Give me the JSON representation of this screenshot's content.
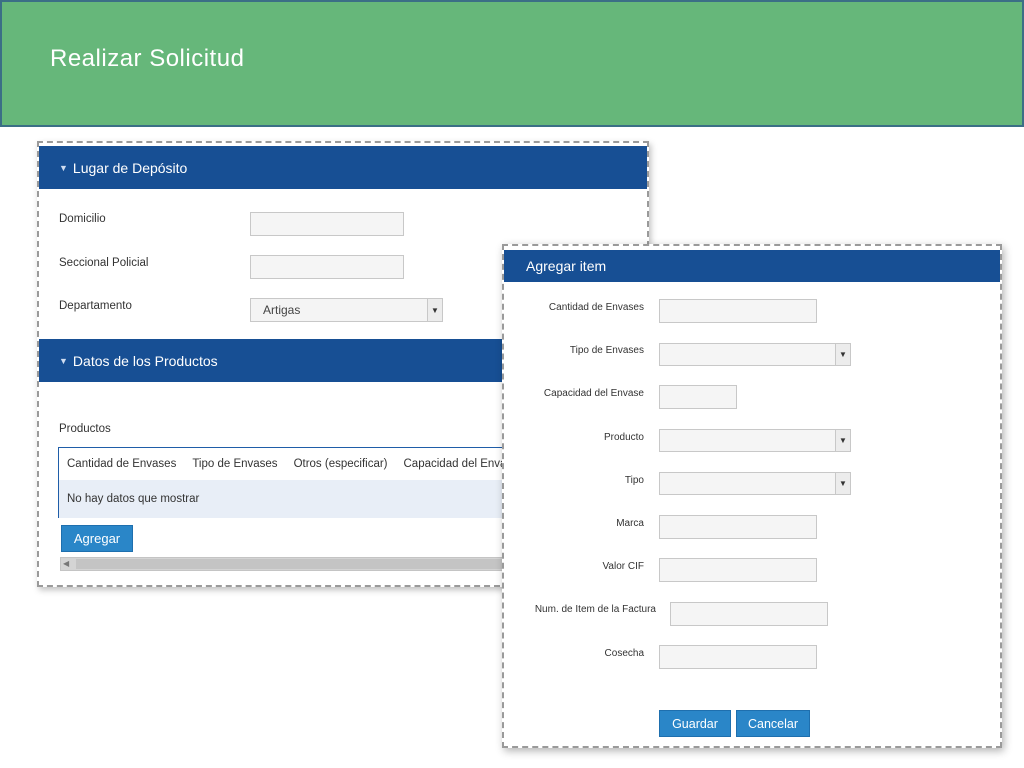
{
  "banner": {
    "title": "Realizar Solicitud"
  },
  "deposit": {
    "header": "Lugar de Depósito",
    "domicilio_label": "Domicilio",
    "domicilio_value": "",
    "seccional_label": "Seccional Policial",
    "seccional_value": "",
    "departamento_label": "Departamento",
    "departamento_value": "Artigas"
  },
  "products": {
    "header": "Datos de los Productos",
    "label": "Productos",
    "columns": [
      "Cantidad de Envases",
      "Tipo de Envases",
      "Otros (especificar)",
      "Capacidad del Envase"
    ],
    "empty_text": "No hay datos que mostrar",
    "add_button": "Agregar"
  },
  "modal": {
    "title": "Agregar item",
    "fields": {
      "cantidad": "Cantidad de Envases",
      "tipo_envases": "Tipo de Envases",
      "capacidad": "Capacidad del Envase",
      "producto": "Producto",
      "tipo": "Tipo",
      "marca": "Marca",
      "valor_cif": "Valor CIF",
      "num_item": "Num. de Item de la Factura",
      "cosecha": "Cosecha"
    },
    "save_button": "Guardar",
    "cancel_button": "Cancelar"
  },
  "icons": {
    "collapse": "triangle-down-icon",
    "dropdown": "chevron-down-icon",
    "scroll_left": "arrow-left-icon"
  },
  "colors": {
    "banner": "#66b77a",
    "section_header": "#174f94",
    "button": "#2a86c8"
  }
}
